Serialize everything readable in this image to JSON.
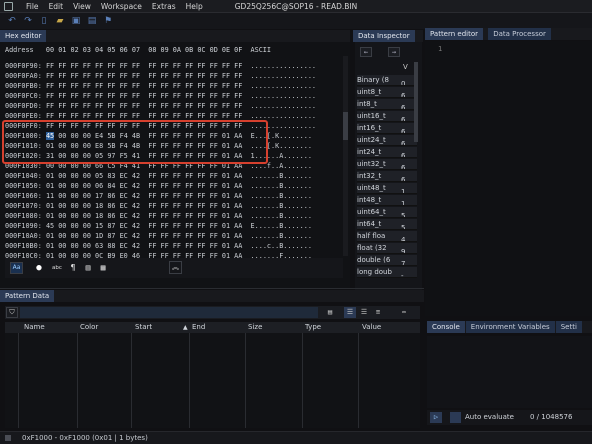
{
  "window": {
    "title": "GD25Q256C@SOP16 - READ.BIN"
  },
  "menu": [
    "File",
    "Edit",
    "View",
    "Workspace",
    "Extras",
    "Help"
  ],
  "tabs": {
    "hex_editor": "Hex editor",
    "data_inspector": "Data Inspector",
    "pattern_editor": "Pattern editor",
    "data_processor": "Data Processor",
    "pattern_data": "Pattern Data",
    "console": "Console",
    "env_vars": "Environment Variables",
    "settings": "Setti"
  },
  "hex": {
    "header": "Address   00 01 02 03 04 05 06 07  08 09 0A 0B 0C 0D 0E 0F  ASCII",
    "rows": [
      {
        "addr": "000F0F90:",
        "bytes": "FF FF FF FF FF FF FF FF  FF FF FF FF FF FF FF FF",
        "ascii": "................"
      },
      {
        "addr": "000F0FA0:",
        "bytes": "FF FF FF FF FF FF FF FF  FF FF FF FF FF FF FF FF",
        "ascii": "................"
      },
      {
        "addr": "000F0FB0:",
        "bytes": "FF FF FF FF FF FF FF FF  FF FF FF FF FF FF FF FF",
        "ascii": "................"
      },
      {
        "addr": "000F0FC0:",
        "bytes": "FF FF FF FF FF FF FF FF  FF FF FF FF FF FF FF FF",
        "ascii": "................"
      },
      {
        "addr": "000F0FD0:",
        "bytes": "FF FF FF FF FF FF FF FF  FF FF FF FF FF FF FF FF",
        "ascii": "................"
      },
      {
        "addr": "000F0FE0:",
        "bytes": "FF FF FF FF FF FF FF FF  FF FF FF FF FF FF FF FF",
        "ascii": "................"
      },
      {
        "addr": "000F0FF0:",
        "bytes": "FF FF FF FF FF FF FF FF  FF FF FF FF FF FF FF FF",
        "ascii": "................"
      },
      {
        "addr": "000F1000:",
        "sel": "45",
        "bytes": " 00 00 00 E4 5B F4 4B  FF FF FF FF FF FF 01 AA",
        "ascii": "E...[.K........"
      },
      {
        "addr": "000F1010:",
        "bytes": "01 00 00 00 E8 5B F4 4B  FF FF FF FF FF FF 01 AA",
        "ascii": "....[.K........"
      },
      {
        "addr": "000F1020:",
        "bytes": "31 00 00 00 05 97 F5 41  FF FF FF FF FF FF 01 AA",
        "ascii": "1......A......."
      },
      {
        "addr": "000F1030:",
        "bytes": "00 00 00 00 66 C5 F4 41  FF FF FF FF FF FF 01 AA",
        "ascii": "....f..A......."
      },
      {
        "addr": "000F1040:",
        "bytes": "01 00 00 00 05 83 EC 42  FF FF FF FF FF FF 01 AA",
        "ascii": ".......B......."
      },
      {
        "addr": "000F1050:",
        "bytes": "01 00 00 00 06 84 EC 42  FF FF FF FF FF FF 01 AA",
        "ascii": ".......B......."
      },
      {
        "addr": "000F1060:",
        "bytes": "11 00 00 00 17 86 EC 42  FF FF FF FF FF FF 01 AA",
        "ascii": ".......B......."
      },
      {
        "addr": "000F1070:",
        "bytes": "01 00 00 00 18 86 EC 42  FF FF FF FF FF FF 01 AA",
        "ascii": ".......B......."
      },
      {
        "addr": "000F1080:",
        "bytes": "01 00 00 00 18 86 EC 42  FF FF FF FF FF FF 01 AA",
        "ascii": ".......B......."
      },
      {
        "addr": "000F1090:",
        "bytes": "45 00 00 00 15 87 EC 42  FF FF FF FF FF FF 01 AA",
        "ascii": "E......B......."
      },
      {
        "addr": "000F10A0:",
        "bytes": "01 00 00 00 1D 87 EC 42  FF FF FF FF FF FF 01 AA",
        "ascii": ".......B......."
      },
      {
        "addr": "000F10B0:",
        "bytes": "01 00 00 00 63 88 EC 42  FF FF FF FF FF FF 01 AA",
        "ascii": "....c..B......."
      },
      {
        "addr": "000F10C0:",
        "bytes": "01 00 00 00 0C B9 E0 46  FF FF FF FF FF FF 01 AA",
        "ascii": ".......F......."
      }
    ]
  },
  "data_inspector": {
    "rows": [
      {
        "type": "Binary (8",
        "val": "0"
      },
      {
        "type": "uint8_t",
        "val": "6"
      },
      {
        "type": "int8_t",
        "val": "6"
      },
      {
        "type": "uint16_t",
        "val": "6"
      },
      {
        "type": "int16_t",
        "val": "6"
      },
      {
        "type": "uint24_t",
        "val": "6"
      },
      {
        "type": "int24_t",
        "val": "6"
      },
      {
        "type": "uint32_t",
        "val": "6"
      },
      {
        "type": "int32_t",
        "val": "6"
      },
      {
        "type": "uint48_t",
        "val": "1"
      },
      {
        "type": "int48_t",
        "val": "1"
      },
      {
        "type": "uint64_t",
        "val": "5"
      },
      {
        "type": "int64_t",
        "val": "5"
      },
      {
        "type": "half floa",
        "val": "4"
      },
      {
        "type": "float (32",
        "val": "9"
      },
      {
        "type": "double (6",
        "val": "7"
      },
      {
        "type": "long doub",
        "val": "-"
      }
    ],
    "header_col": "V"
  },
  "pattern_editor": {
    "line_number": "1"
  },
  "pattern_table": {
    "columns": [
      "Name",
      "Color",
      "Start",
      "End",
      "Size",
      "Type",
      "Value"
    ]
  },
  "console_footer": {
    "auto_evaluate": "Auto evaluate",
    "counter": "0 / 1048576"
  },
  "status": {
    "selection": "0xF1000 - 0xF1000 (0x01 | 1 bytes)"
  },
  "accent": "#2b3a55",
  "highlight_color": "#d6402e",
  "hex_tool_icons": [
    "font-icon",
    "bulb-icon",
    "abc-icon",
    "paragraph-icon",
    "map-icon",
    "grid-icon"
  ]
}
